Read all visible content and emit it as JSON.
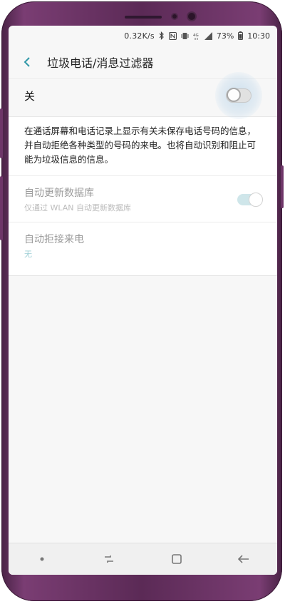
{
  "status_bar": {
    "speed": "0.32K/s",
    "battery": "73%",
    "time": "10:30",
    "icons": [
      "bluetooth-icon",
      "nfc-icon",
      "vibrate-icon",
      "4g-icon",
      "signal-icon",
      "battery-icon"
    ]
  },
  "app_bar": {
    "title": "垃圾电话/消息过滤器",
    "back_icon": "back-arrow-icon",
    "accent": "#2f97a7"
  },
  "master_switch": {
    "label": "关",
    "state": "off"
  },
  "description": "在通话屏幕和电话记录上显示有关未保存电话号码的信息，并自动拒绝各种类型的号码的来电。也将自动识别和阻止可能为垃圾信息的信息。",
  "settings": [
    {
      "title": "自动更新数据库",
      "subtitle": "仅通过 WLAN 自动更新数据库",
      "toggle": "on-disabled"
    },
    {
      "title": "自动拒接来电",
      "subtitle": "无"
    }
  ],
  "nav_bar": {
    "buttons": [
      "dot-indicator-icon",
      "recent-apps-icon",
      "home-icon",
      "back-icon"
    ]
  }
}
